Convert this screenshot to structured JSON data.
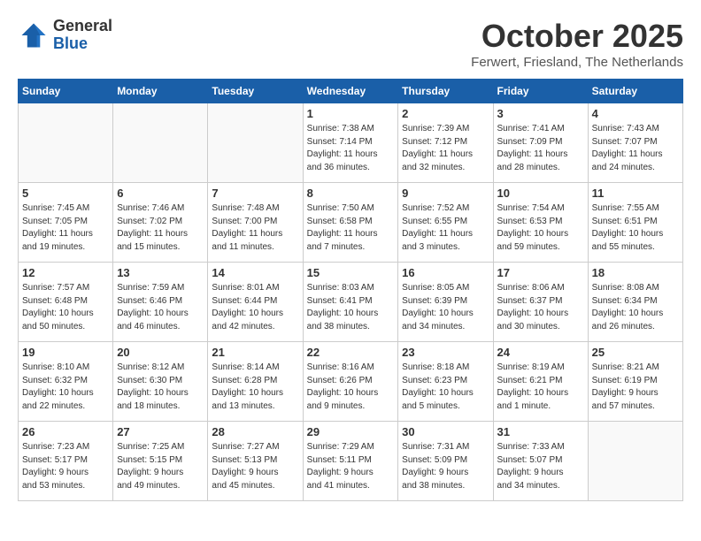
{
  "header": {
    "logo_line1": "General",
    "logo_line2": "Blue",
    "month": "October 2025",
    "location": "Ferwert, Friesland, The Netherlands"
  },
  "weekdays": [
    "Sunday",
    "Monday",
    "Tuesday",
    "Wednesday",
    "Thursday",
    "Friday",
    "Saturday"
  ],
  "weeks": [
    [
      {
        "day": "",
        "info": ""
      },
      {
        "day": "",
        "info": ""
      },
      {
        "day": "",
        "info": ""
      },
      {
        "day": "1",
        "info": "Sunrise: 7:38 AM\nSunset: 7:14 PM\nDaylight: 11 hours\nand 36 minutes."
      },
      {
        "day": "2",
        "info": "Sunrise: 7:39 AM\nSunset: 7:12 PM\nDaylight: 11 hours\nand 32 minutes."
      },
      {
        "day": "3",
        "info": "Sunrise: 7:41 AM\nSunset: 7:09 PM\nDaylight: 11 hours\nand 28 minutes."
      },
      {
        "day": "4",
        "info": "Sunrise: 7:43 AM\nSunset: 7:07 PM\nDaylight: 11 hours\nand 24 minutes."
      }
    ],
    [
      {
        "day": "5",
        "info": "Sunrise: 7:45 AM\nSunset: 7:05 PM\nDaylight: 11 hours\nand 19 minutes."
      },
      {
        "day": "6",
        "info": "Sunrise: 7:46 AM\nSunset: 7:02 PM\nDaylight: 11 hours\nand 15 minutes."
      },
      {
        "day": "7",
        "info": "Sunrise: 7:48 AM\nSunset: 7:00 PM\nDaylight: 11 hours\nand 11 minutes."
      },
      {
        "day": "8",
        "info": "Sunrise: 7:50 AM\nSunset: 6:58 PM\nDaylight: 11 hours\nand 7 minutes."
      },
      {
        "day": "9",
        "info": "Sunrise: 7:52 AM\nSunset: 6:55 PM\nDaylight: 11 hours\nand 3 minutes."
      },
      {
        "day": "10",
        "info": "Sunrise: 7:54 AM\nSunset: 6:53 PM\nDaylight: 10 hours\nand 59 minutes."
      },
      {
        "day": "11",
        "info": "Sunrise: 7:55 AM\nSunset: 6:51 PM\nDaylight: 10 hours\nand 55 minutes."
      }
    ],
    [
      {
        "day": "12",
        "info": "Sunrise: 7:57 AM\nSunset: 6:48 PM\nDaylight: 10 hours\nand 50 minutes."
      },
      {
        "day": "13",
        "info": "Sunrise: 7:59 AM\nSunset: 6:46 PM\nDaylight: 10 hours\nand 46 minutes."
      },
      {
        "day": "14",
        "info": "Sunrise: 8:01 AM\nSunset: 6:44 PM\nDaylight: 10 hours\nand 42 minutes."
      },
      {
        "day": "15",
        "info": "Sunrise: 8:03 AM\nSunset: 6:41 PM\nDaylight: 10 hours\nand 38 minutes."
      },
      {
        "day": "16",
        "info": "Sunrise: 8:05 AM\nSunset: 6:39 PM\nDaylight: 10 hours\nand 34 minutes."
      },
      {
        "day": "17",
        "info": "Sunrise: 8:06 AM\nSunset: 6:37 PM\nDaylight: 10 hours\nand 30 minutes."
      },
      {
        "day": "18",
        "info": "Sunrise: 8:08 AM\nSunset: 6:34 PM\nDaylight: 10 hours\nand 26 minutes."
      }
    ],
    [
      {
        "day": "19",
        "info": "Sunrise: 8:10 AM\nSunset: 6:32 PM\nDaylight: 10 hours\nand 22 minutes."
      },
      {
        "day": "20",
        "info": "Sunrise: 8:12 AM\nSunset: 6:30 PM\nDaylight: 10 hours\nand 18 minutes."
      },
      {
        "day": "21",
        "info": "Sunrise: 8:14 AM\nSunset: 6:28 PM\nDaylight: 10 hours\nand 13 minutes."
      },
      {
        "day": "22",
        "info": "Sunrise: 8:16 AM\nSunset: 6:26 PM\nDaylight: 10 hours\nand 9 minutes."
      },
      {
        "day": "23",
        "info": "Sunrise: 8:18 AM\nSunset: 6:23 PM\nDaylight: 10 hours\nand 5 minutes."
      },
      {
        "day": "24",
        "info": "Sunrise: 8:19 AM\nSunset: 6:21 PM\nDaylight: 10 hours\nand 1 minute."
      },
      {
        "day": "25",
        "info": "Sunrise: 8:21 AM\nSunset: 6:19 PM\nDaylight: 9 hours\nand 57 minutes."
      }
    ],
    [
      {
        "day": "26",
        "info": "Sunrise: 7:23 AM\nSunset: 5:17 PM\nDaylight: 9 hours\nand 53 minutes."
      },
      {
        "day": "27",
        "info": "Sunrise: 7:25 AM\nSunset: 5:15 PM\nDaylight: 9 hours\nand 49 minutes."
      },
      {
        "day": "28",
        "info": "Sunrise: 7:27 AM\nSunset: 5:13 PM\nDaylight: 9 hours\nand 45 minutes."
      },
      {
        "day": "29",
        "info": "Sunrise: 7:29 AM\nSunset: 5:11 PM\nDaylight: 9 hours\nand 41 minutes."
      },
      {
        "day": "30",
        "info": "Sunrise: 7:31 AM\nSunset: 5:09 PM\nDaylight: 9 hours\nand 38 minutes."
      },
      {
        "day": "31",
        "info": "Sunrise: 7:33 AM\nSunset: 5:07 PM\nDaylight: 9 hours\nand 34 minutes."
      },
      {
        "day": "",
        "info": ""
      }
    ]
  ]
}
